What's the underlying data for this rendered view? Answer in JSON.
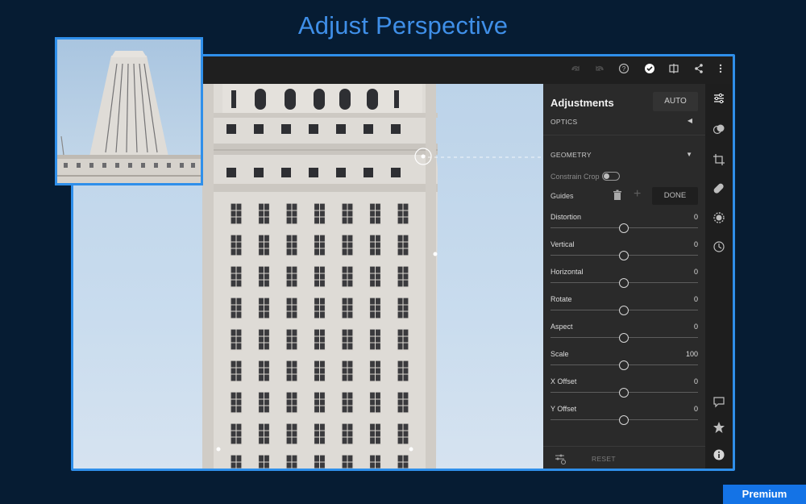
{
  "headline": "Adjust Perspective",
  "toolbar": {
    "icons": [
      "redo-icon",
      "undo-icon",
      "help-icon",
      "done-check-icon",
      "compare-icon",
      "share-icon",
      "more-vertical-icon"
    ]
  },
  "panel": {
    "title": "Adjustments",
    "auto_label": "AUTO",
    "optics_label": "OPTICS",
    "geometry_label": "GEOMETRY",
    "constrain_crop_label": "Constrain Crop",
    "guides_label": "Guides",
    "done_label": "DONE",
    "sliders": [
      {
        "name": "Distortion",
        "value": "0"
      },
      {
        "name": "Vertical",
        "value": "0"
      },
      {
        "name": "Horizontal",
        "value": "0"
      },
      {
        "name": "Rotate",
        "value": "0"
      },
      {
        "name": "Aspect",
        "value": "0"
      },
      {
        "name": "Scale",
        "value": "100"
      },
      {
        "name": "X Offset",
        "value": "0"
      },
      {
        "name": "Y Offset",
        "value": "0"
      }
    ],
    "reset_label": "RESET"
  },
  "rail": {
    "icons": [
      "edit-sliders-icon",
      "presets-icon",
      "crop-icon",
      "healing-icon",
      "selective-icon",
      "history-icon",
      "comment-icon",
      "rating-star-icon",
      "info-icon"
    ]
  },
  "badge": "Premium",
  "colors": {
    "accent": "#2f8fea",
    "background": "#061c33",
    "badge": "#1473e6"
  }
}
